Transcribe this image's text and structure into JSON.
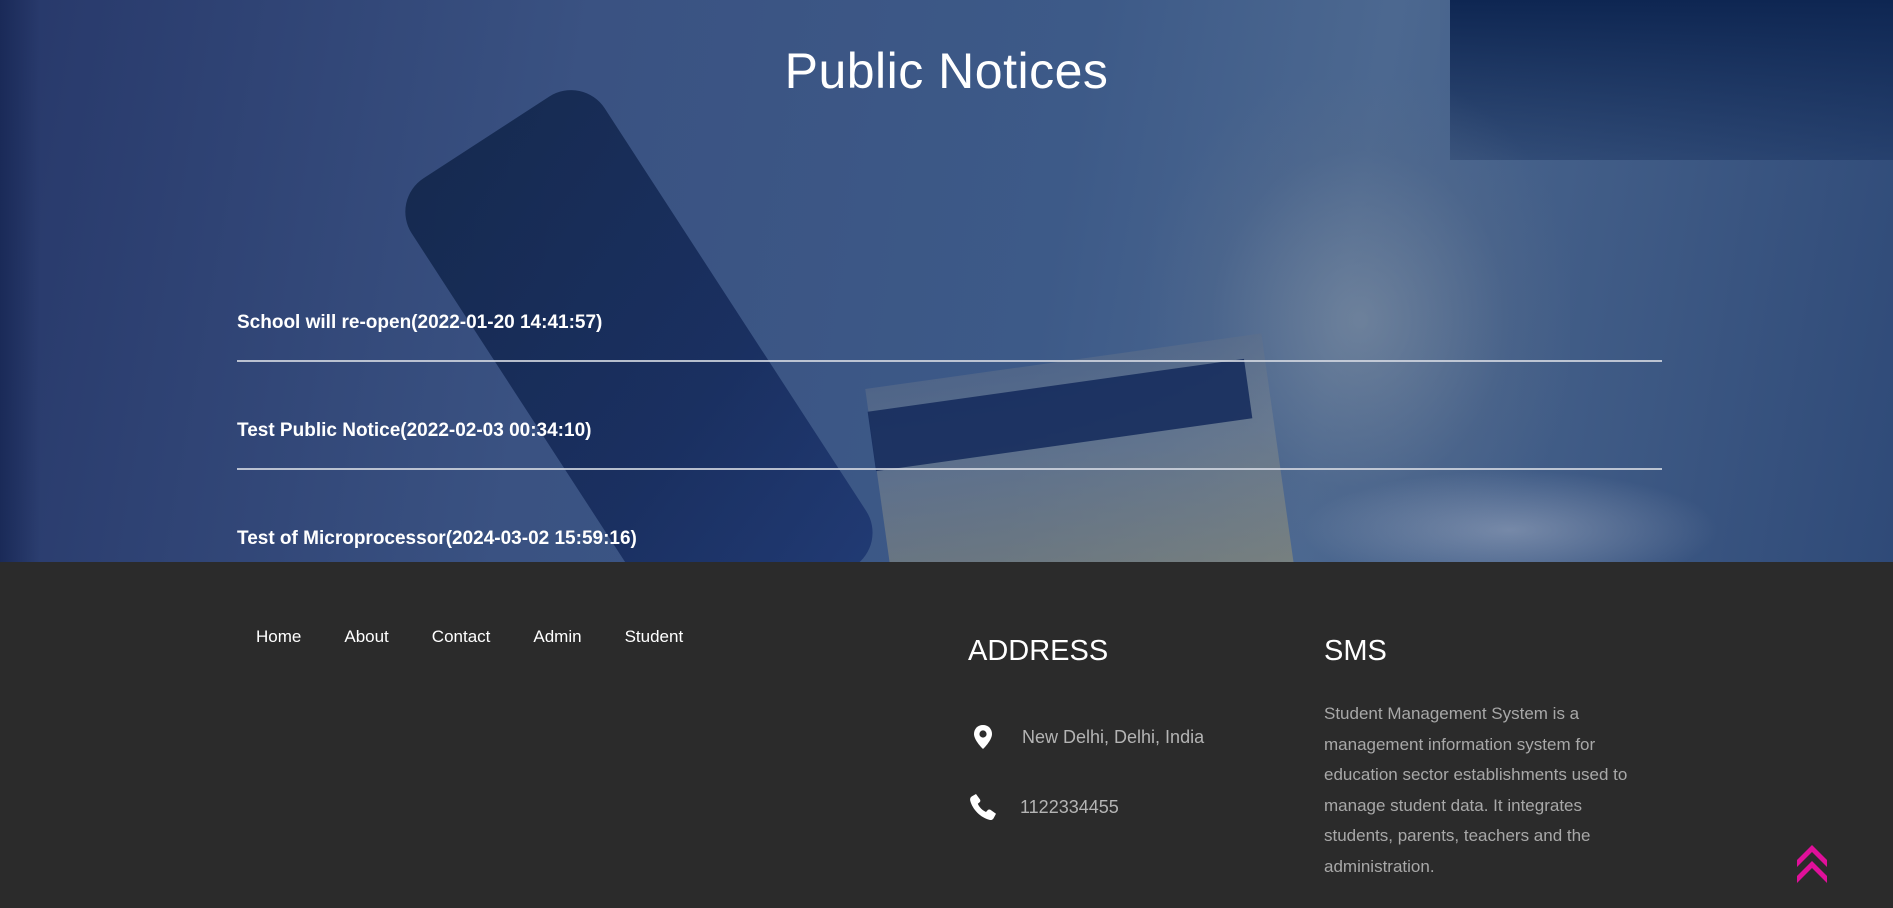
{
  "hero": {
    "title": "Public Notices"
  },
  "notices": [
    {
      "text": "School will re-open(2022-01-20 14:41:57)"
    },
    {
      "text": "Test Public Notice(2022-02-03 00:34:10)"
    },
    {
      "text": "Test of Microprocessor(2024-03-02 15:59:16)"
    }
  ],
  "footer": {
    "nav": [
      "Home",
      "About",
      "Contact",
      "Admin",
      "Student"
    ],
    "address": {
      "heading": "ADDRESS",
      "location": "New Delhi, Delhi, India",
      "phone": "1122334455",
      "location_icon": "map-pin-icon",
      "phone_icon": "phone-icon"
    },
    "sms": {
      "heading": "SMS",
      "description": "Student Management System is a management information system for education sector establishments used to manage student data. It integrates students, parents, teachers and the administration."
    }
  },
  "scroll_top": {
    "icon": "double-chevron-up-icon",
    "color": "#e0109a"
  }
}
